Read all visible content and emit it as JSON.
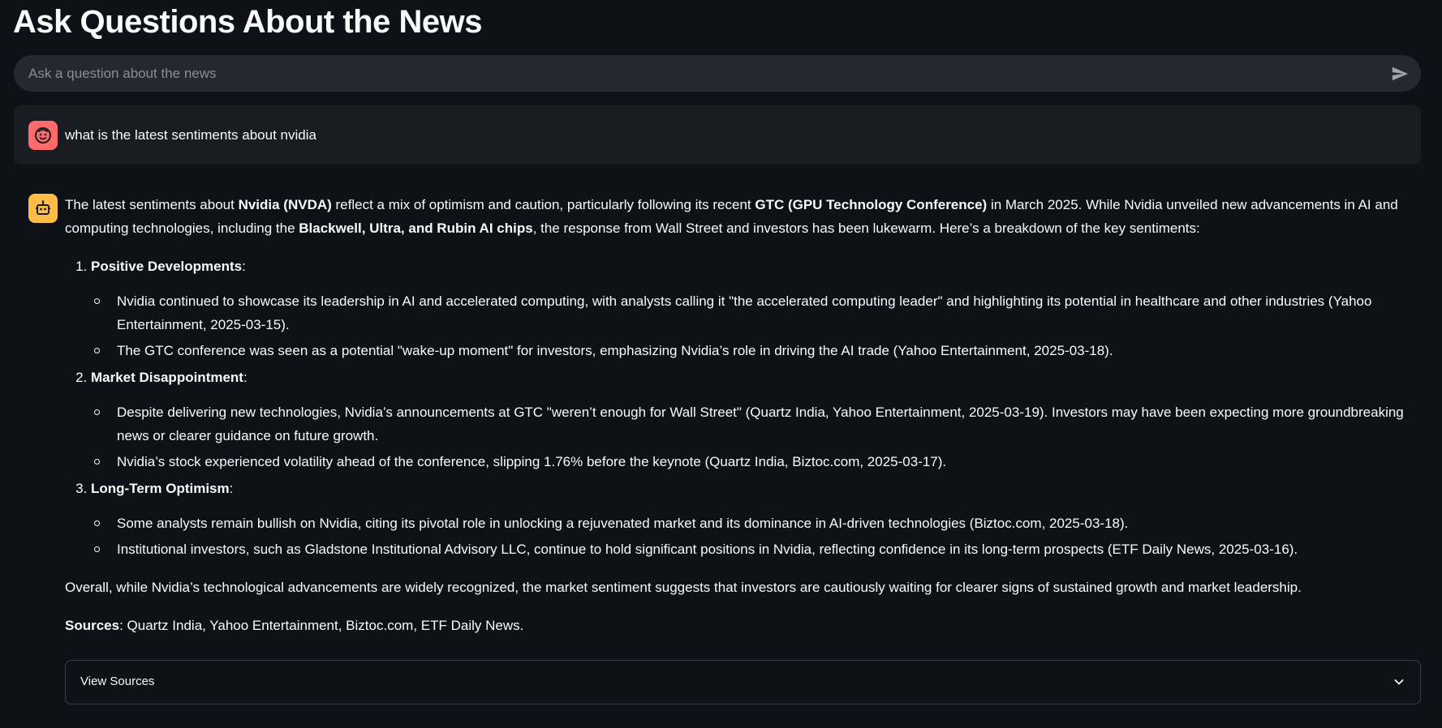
{
  "title": "Ask Questions About the News",
  "chat_input": {
    "placeholder": "Ask a question about the news"
  },
  "user_message": {
    "text": "what is the latest sentiments about nvidia"
  },
  "assistant_message": {
    "intro": {
      "t1": "The latest sentiments about ",
      "b1": "Nvidia (NVDA)",
      "t2": " reflect a mix of optimism and caution, particularly following its recent ",
      "b2": "GTC (GPU Technology Conference)",
      "t3": " in March 2025. While Nvidia unveiled new advancements in AI and computing technologies, including the ",
      "b3": "Blackwell, Ultra, and Rubin AI chips",
      "t4": ", the response from Wall Street and investors has been lukewarm. Here’s a breakdown of the key sentiments:"
    },
    "sections": [
      {
        "heading": "Positive Developments",
        "bullets": [
          "Nvidia continued to showcase its leadership in AI and accelerated computing, with analysts calling it \"the accelerated computing leader\" and highlighting its potential in healthcare and other industries (Yahoo Entertainment, 2025-03-15).",
          "The GTC conference was seen as a potential \"wake-up moment\" for investors, emphasizing Nvidia’s role in driving the AI trade (Yahoo Entertainment, 2025-03-18)."
        ]
      },
      {
        "heading": "Market Disappointment",
        "bullets": [
          "Despite delivering new technologies, Nvidia’s announcements at GTC \"weren’t enough for Wall Street\" (Quartz India, Yahoo Entertainment, 2025-03-19). Investors may have been expecting more groundbreaking news or clearer guidance on future growth.",
          "Nvidia’s stock experienced volatility ahead of the conference, slipping 1.76% before the keynote (Quartz India, Biztoc.com, 2025-03-17)."
        ]
      },
      {
        "heading": "Long-Term Optimism",
        "bullets": [
          "Some analysts remain bullish on Nvidia, citing its pivotal role in unlocking a rejuvenated market and its dominance in AI-driven technologies (Biztoc.com, 2025-03-18).",
          "Institutional investors, such as Gladstone Institutional Advisory LLC, continue to hold significant positions in Nvidia, reflecting confidence in its long-term prospects (ETF Daily News, 2025-03-16)."
        ]
      }
    ],
    "overall": "Overall, while Nvidia’s technological advancements are widely recognized, the market sentiment suggests that investors are cautiously waiting for clearer signs of sustained growth and market leadership.",
    "sources_label": "Sources",
    "sources_text": ": Quartz India, Yahoo Entertainment, Biztoc.com, ETF Daily News."
  },
  "expander": {
    "label": "View Sources"
  },
  "colors": {
    "background": "#0e1117",
    "input_bg": "#262730",
    "user_msg_bg": "#1a1c24",
    "user_avatar": "#ff6b6b",
    "bot_avatar": "#ffbd45"
  },
  "icons": {
    "send": "send-icon",
    "user_avatar": "user-face-icon",
    "bot_avatar": "robot-icon",
    "expander": "chevron-down-icon"
  }
}
